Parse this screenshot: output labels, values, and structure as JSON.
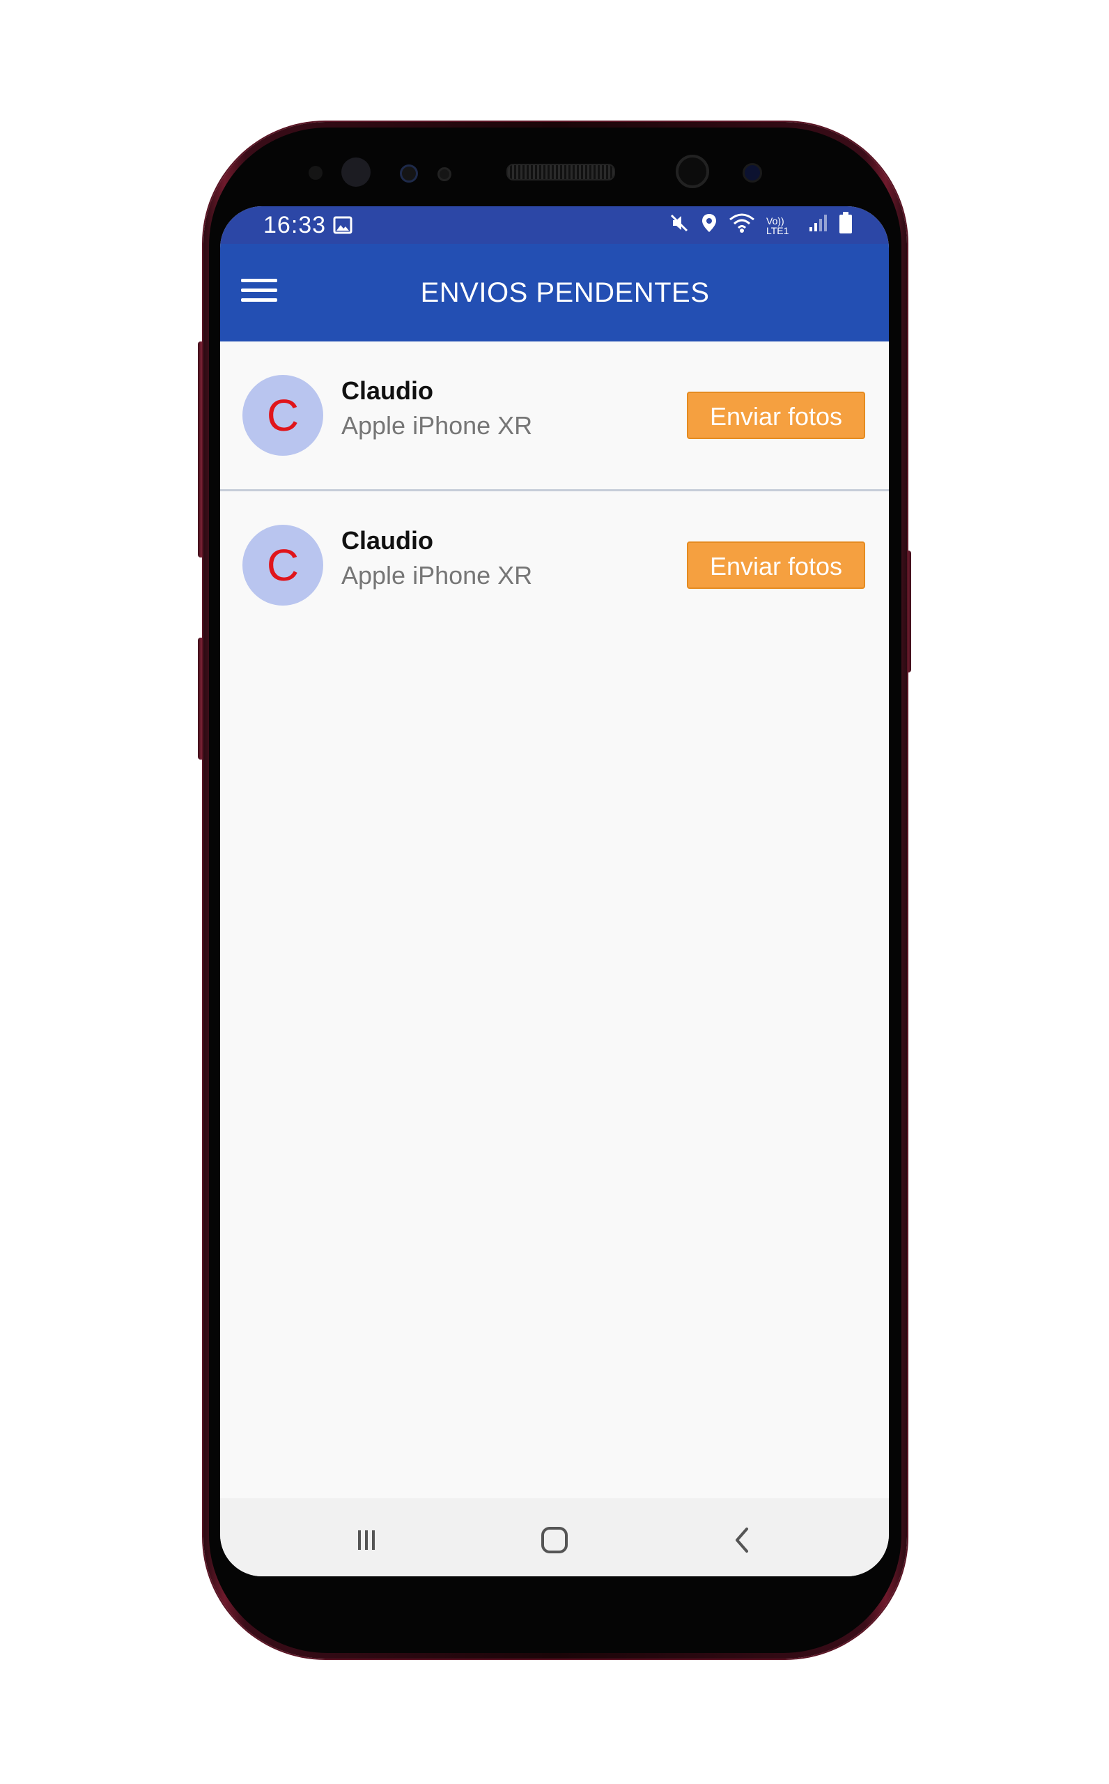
{
  "status_bar": {
    "time": "16:33",
    "icons": [
      "image-icon",
      "mute-icon",
      "location-icon",
      "wifi-icon",
      "volte-icon",
      "signal-icon",
      "battery-icon"
    ],
    "volte_label": "Vo)) LTE1"
  },
  "app_bar": {
    "title": "ENVIOS PENDENTES",
    "menu_icon": "hamburger-menu-icon"
  },
  "list": {
    "items": [
      {
        "avatar_letter": "C",
        "name": "Claudio",
        "device": "Apple iPhone XR",
        "button_label": "Enviar fotos"
      },
      {
        "avatar_letter": "C",
        "name": "Claudio",
        "device": "Apple iPhone XR",
        "button_label": "Enviar fotos"
      }
    ]
  },
  "nav_bar": {
    "icons": [
      "recent-apps-icon",
      "home-icon",
      "back-icon"
    ]
  },
  "colors": {
    "app_bar": "#234fb3",
    "status_bar": "#2c47a6",
    "button": "#f5a040",
    "avatar_bg": "#b9c5ef",
    "avatar_letter": "#e0151b"
  }
}
